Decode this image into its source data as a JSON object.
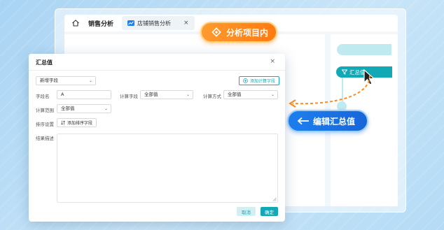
{
  "app": {
    "title": "销售分析",
    "tab_label": "店铺销售分析",
    "tab_close": "×"
  },
  "flow": {
    "node_label": "汇总值"
  },
  "callouts": {
    "orange": "分析项目内",
    "blue": "编辑汇总值"
  },
  "dialog": {
    "title": "汇总值",
    "close": "×",
    "new_field_select": "新增字段",
    "add_calc_field_button": "添加计算字段",
    "field_name_label": "字段名",
    "field_name_value": "A",
    "calc_field_label": "计算字段",
    "calc_field_value": "全部值",
    "calc_method_label": "计算方式",
    "calc_method_value": "全部值",
    "calc_range_label": "计算范围",
    "calc_range_value": "全部值",
    "sort_label": "排序设置",
    "add_sort_button": "添加排序字段",
    "result_desc_label": "结果描述",
    "cancel": "取消",
    "ok": "确定"
  },
  "colors": {
    "accent": "#12a9b5",
    "orange": "#ff8a1e",
    "blue": "#1e7ff0"
  }
}
